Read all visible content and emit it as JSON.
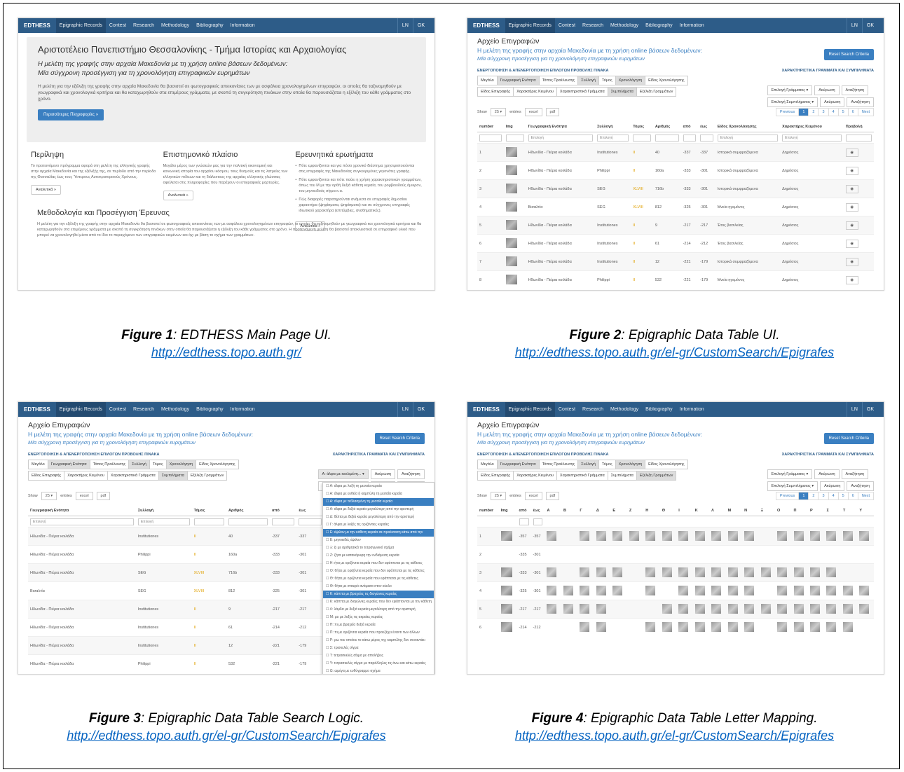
{
  "nav": {
    "brand": "EDTHESS",
    "items": [
      "Epigraphic Records",
      "Contest",
      "Research",
      "Methodology",
      "Bibliography",
      "Information"
    ],
    "langs": [
      "LN",
      "GK"
    ]
  },
  "fig1": {
    "title": "Αριστοτέλειο Πανεπιστήμιο Θεσσαλονίκης - Τμήμα Ιστορίας και Αρχαιολογίας",
    "sub1": "Η μελέτη της γραφής στην αρχαία Μακεδονία με τη χρήση online βάσεων δεδομένων:",
    "sub2": "Μία σύγχρονη προσέγγιση για τη χρονολόγηση επιγραφικών ευρημάτων",
    "intro": "Η μελέτη για την εξέλιξη της γραφής στην αρχαία Μακεδονία θα βασιστεί σε φωτογραφικές απεικονίσεις των με ασφάλεια χρονολογημένων επιγραφών, οι οποίες θα ταξινομηθούν με γεωγραφικά και χρονολογικά κριτήρια και θα καταχωρηθούν στα επιμέρους γράμματα, με σκοπό τη συγκρότηση πινάκων στην οποία θα παρουσιάζεται η εξέλιξη του κάθε γράμματος στο χρόνο.",
    "more": "Περισσότερες Πληροφορίες »",
    "c1t": "Περίληψη",
    "c1p": "Το προτεινόμενο πρόγραμμα αφορά στη μελέτη της ελληνικής γραφής στην αρχαία Μακεδονία και της εξέλιξής της, σε περίοδο από την περίοδο της Θεσσαλίας έως τους Ύστερους Αυτοκρατορικούς Χρόνους.",
    "c1b": "Αναλυτικά »",
    "c2t": "Επιστημονικό πλαίσιο",
    "c2p": "Μεγάλο μέρος των γνώσεών μας για την πολιτική οικονομική και κοινωνική ιστορία του αρχαίου κόσμου, τους θεσμούς και τις λατρείες των ελληνικών πόλεων και τη διάλεκτους της αρχαίας ελληνικής γλώσσας οφείλεται στις πληροφορίες που παρέχουν οι επιγραφικές μαρτυρίες.",
    "c2b": "Αναλυτικά »",
    "c3t": "Ερευνητικά ερωτήματα",
    "c3items": [
      "Πότε εμφανίζονται και για πόσο χρονικό διάστημα χρησιμοποιούνται στις επιγραφές της Μακεδονίας συγκεκριμένες γεγονότες γραφής.",
      "Πότε εμφανίζονται και πότε παύει η χρήση χαρακτηριστικών γραμμάτων, όπως του Μ με την ορθή δεξιά κάθετη κεραία, του ρομβοειδούς όμικρον, του μηνοειδούς σίγμα κ.α.",
      "Πώς διαφορές παρατηρούνται ανάμεσα σε επιγραφές δημοσίου χαρακτήρα (ψηφίσματα, ψηφίσματα) και σε σύγχρονες επιγραφές ιδιωτικού χαρακτήρα (επιτύμβιες, αναθηματικές)."
    ],
    "c3b": "Αναλυτικά »",
    "s2t": "Μεθοδολογία και Προσέγγιση Έρευνας",
    "s2p": "Η μελέτη για την εξέλιξη της γραφής στην αρχαία Μακεδονία θα βασιστεί σε φωτογραφικές απεικονίσεις των με ασφάλεια χρονολογημένων επιγραφών, οι οποίες θα ταξινομηθούν με γεωγραφικά και χρονολογικά κριτήρια και θα καταχωρηθούν στα επιμέρους γράμματα με σκοπό τη συγκρότηση πινάκων στην οποία θα παρουσιάζεται η εξέλιξη του κάθε γράμματος στο χρόνο. Η προτεινόμενη μελέτη θα βασιστεί αποκλειστικά σε επιγραφικό υλικό που μπορεί να χρονολογηθεί μέσα από το ίδιο το περιεχόμενο των επιγραφικών κειμένων και όχι με βάση το σχήμα των γραμμάτων."
  },
  "figA": {
    "title": "Αρχείο Επιγραφών",
    "l1": "Η μελέτη της γραφής στην αρχαία Μακεδονία με τη χρήση online βάσεων δεδομένων:",
    "l2": "Μία σύγχρονη προσέγγιση για τη χρονολόγηση επιγραφικών ευρημάτων",
    "reset": "Reset Search Criteria",
    "hl": "ΕΝΕΡΓΟΠΟΙΗΣΗ & ΑΠΕΝΕΡΓΟΠΟΙΗΣΗ ΕΠΙΛΟΓΩΝ ΠΡΟΒΟΛΗΣ ΠΙΝΑΚΑ",
    "hr": "ΧΑΡΑΚΤΗΡΙΣΤΙΚΑ ΓΡΑΜΜΑΤΑ ΚΑΙ ΣΥΜΠΙΛΗΜΑΤΑ",
    "toggles": [
      "Μεγάλο",
      "Γεωγραφική Ενότητα",
      "Τόπος Προέλευσης",
      "Συλλογή",
      "Τόμος",
      "Χρονολόγηση",
      "Είδος Χρονολόγησης",
      "Είδος Επιγραφής",
      "Χαρακτήρες Κειμένου",
      "Χαρακτηριστικά Γράμματα",
      "Συμπιλήματα",
      "Εξέλιξη Γραμμάτων"
    ],
    "rsel1": "Επιλογή Γράμματος ▾",
    "rsel2": "Επιλογή Συμπιλήματος ▾",
    "clear": "Ακύρωση",
    "search": "Αναζήτηση",
    "show": "Show",
    "n": "25",
    "entries": "entries",
    "excel": "excel",
    "pdf": "pdf",
    "prev": "Previous",
    "next": "Next",
    "pages": [
      "1",
      "2",
      "3",
      "4",
      "5",
      "6"
    ],
    "cols": [
      "number",
      "Img",
      "Γεωγραφική Ενότητα",
      "Συλλογή",
      "Τόμος",
      "Αριθμός",
      "από",
      "έως",
      "Είδος Χρονολόγησης",
      "Χαρακτήρες Κειμένου",
      "Προβολή"
    ],
    "pick": "Επιλογή",
    "rows": [
      [
        "1",
        "Ηδωνίδα - Πιέρια κοιλάδα",
        "Institutiones",
        "II",
        "40",
        "-337",
        "-337",
        "Ιστορικά συμφραζόμενα",
        "Δημόσιος"
      ],
      [
        "2",
        "Ηδωνίδα - Πιέρια κοιλάδα",
        "Philippi",
        "II",
        "160a",
        "-333",
        "-301",
        "Ιστορικά συμφραζόμενα",
        "Δημόσιος"
      ],
      [
        "3",
        "Ηδωνίδα - Πιέρια κοιλάδα",
        "SEG",
        "XLVIII",
        "716b",
        "-333",
        "-301",
        "Ιστορικά συμφραζόμενα",
        "Δημόσιος"
      ],
      [
        "4",
        "Βισαλτία",
        "SEG",
        "XLVIII",
        "812",
        "-325",
        "-301",
        "Μνεία ηγεμόνος",
        "Δημόσιος"
      ],
      [
        "5",
        "Ηδωνίδα - Πιέρια κοιλάδα",
        "Institutiones",
        "II",
        "9",
        "-217",
        "-217",
        "Έτος βασιλείας",
        "Δημόσιος"
      ],
      [
        "6",
        "Ηδωνίδα - Πιέρια κοιλάδα",
        "Institutiones",
        "II",
        "61",
        "-214",
        "-212",
        "Έτος βασιλείας",
        "Δημόσιος"
      ],
      [
        "7",
        "Ηδωνίδα - Πιέρια κοιλάδα",
        "Institutiones",
        "II",
        "12",
        "-221",
        "-179",
        "Ιστορικά συμφραζόμενα",
        "Δημόσιος"
      ],
      [
        "8",
        "Ηδωνίδα - Πιέρια κοιλάδα",
        "Philippi",
        "II",
        "532",
        "-221",
        "-179",
        "Μνεία ηγεμόνος",
        "Δημόσιος"
      ]
    ],
    "ddTop": "Α: άλφα με κεκλιμένη...",
    "dd": [
      "Α: άλφα με λοξή τη μεσαία κεραία",
      "Α: άλφα με ευθεία ή καμπύλη τη μεσαία κεραία",
      "Α: άλφα με τεθλασμένη τη μεσαία κεραία",
      "Α: άλφα με δεξιά κεραία μεγαλύτερη από την αριστερή",
      "Δ: δέλτα με δεξιά κεραία μεγαλύτερη από την αριστερή",
      "Γ: άλφα με λοξές τις οριζόντιες κεραίες",
      "Ε: έψιλον με την κάθετη κεραία σε προέκταση κάτω από την",
      "Ε: μηνοειδές έψιλον",
      "Ξ: ξι με αριθμητικά το τετραγωνικό σχήμα",
      "Ζ: ζήτα με κατακόρυφη την ενδιάμεση κεραία",
      "Η: ήτα με οριζόντια κεραία που δεν εφάπτεται με τις κάθετες",
      "Ο: θήτα με οριζόντια κεραία που δεν εφάπτεται με τις κάθετες",
      "Θ: θήτα με οριζόντια κεραία που εφάπτεται με τις κάθετες",
      "Θ: θήτα με σταυρό ανάμεσα στον κύκλο",
      "Κ: κάππα με βραχείες τις διαγώνιες κεραίες",
      "Κ: κάππα με διαγώνιες κεραίες που δεν εφάπτονται με την κάθετη",
      "Λ: λάμδα με δεξιά κεραία μεγαλύτερη από την αριστερή",
      "Μ: μυ με λοξές τις ακραίες κεραίες",
      "Π: πι με βραχεία δεξιά κεραία",
      "Π: πι με οριζόντια κεραία που προεξέχει έναντι των άλλων",
      "Ρ: ρω του οποίου το κάτω μέρος της καμπύλης δεν συναντάει",
      "Σ: τρισκελές σίγμα",
      "Τ: τετρασκελές σίγμα με απολήξεις",
      "Υ: τετρασκελές σίγμα με παράλληλες τις άνω και κάτω κεραίες",
      "Ω: ωμέγα με ευθύγραμμο σχήμα"
    ],
    "ddSel": [
      2,
      6,
      14
    ],
    "letters": [
      "Α",
      "Β",
      "Γ",
      "Δ",
      "Ε",
      "Ζ",
      "Η",
      "Θ",
      "Ι",
      "Κ",
      "Λ",
      "Μ",
      "Ν",
      "Ξ",
      "Ο",
      "Π",
      "Ρ",
      "Σ",
      "Τ",
      "Υ"
    ],
    "lrows": [
      [
        "1",
        "-357",
        "-357"
      ],
      [
        "2",
        "-335",
        "-301"
      ],
      [
        "3",
        "-333",
        "-301"
      ],
      [
        "4",
        "-325",
        "-301"
      ],
      [
        "5",
        "-217",
        "-217"
      ],
      [
        "6",
        "-214",
        "-212"
      ]
    ]
  },
  "captions": [
    {
      "fig": "Figure 1",
      "txt": ": EDTHESS Main Page UI.",
      "url": "http://edthess.topo.auth.gr/"
    },
    {
      "fig": "Figure 2",
      "txt": ": Epigraphic Data Table UI.",
      "url": "http://edthess.topo.auth.gr/el-gr/CustomSearch/Epigrafes"
    },
    {
      "fig": "Figure 3",
      "txt": ": Epigraphic Data Table Search Logic.",
      "url": "http://edthess.topo.auth.gr/el-gr/CustomSearch/Epigrafes"
    },
    {
      "fig": "Figure 4",
      "txt": ": Epigraphic Data Table Letter Mapping.",
      "url": "http://edthess.topo.auth.gr/el-gr/CustomSearch/Epigrafes"
    }
  ]
}
